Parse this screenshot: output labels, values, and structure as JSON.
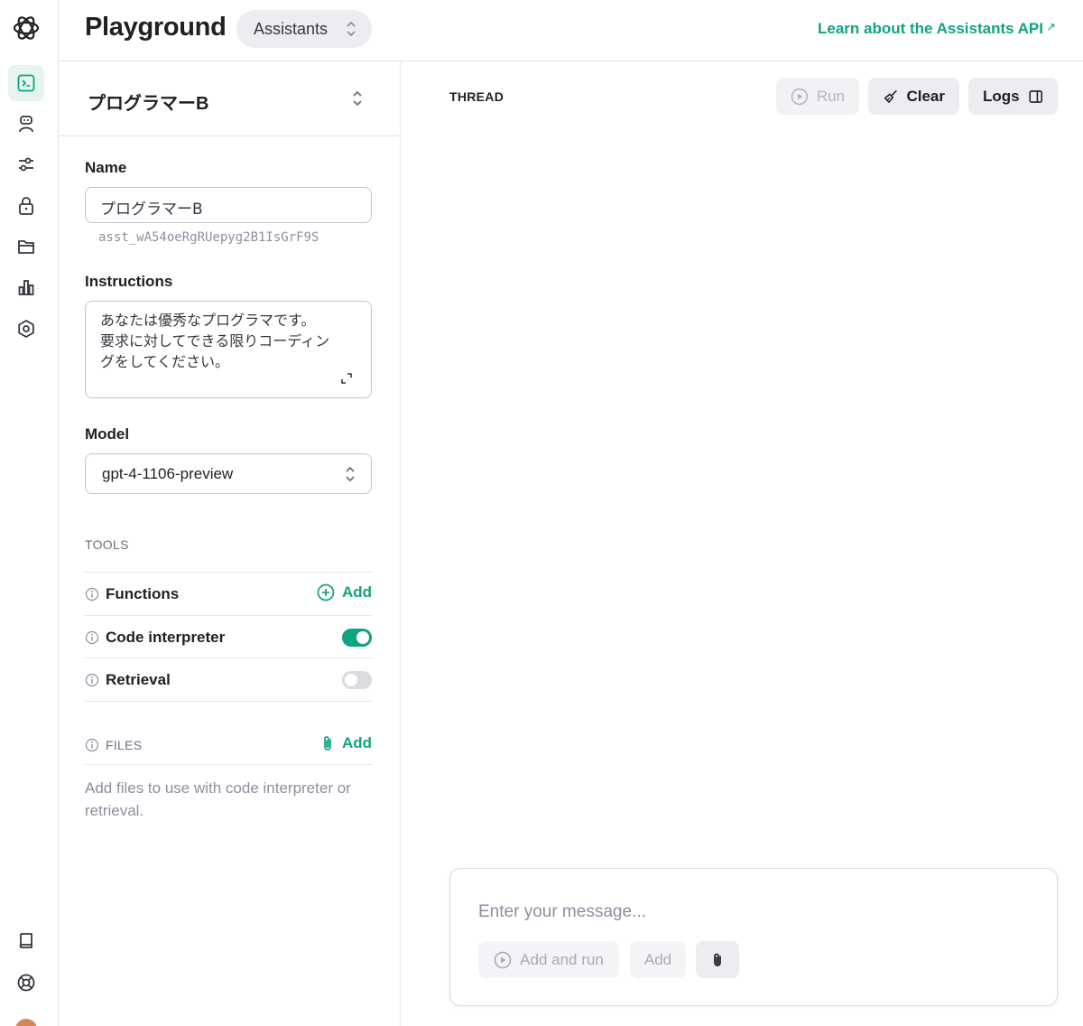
{
  "header": {
    "title": "Playground",
    "mode": "Assistants",
    "learn_link": "Learn about the Assistants API",
    "learn_arrow": "↗"
  },
  "rail": {
    "items": [
      "playground-icon",
      "assistant-icon",
      "tuning-icon",
      "lock-icon",
      "folder-icon",
      "usage-icon",
      "settings-icon"
    ],
    "bottom": [
      "docs-icon",
      "help-icon"
    ],
    "accent": "#10a37f"
  },
  "assistant": {
    "selected": "プログラマーB"
  },
  "form": {
    "name_label": "Name",
    "name_value": "プログラマーB",
    "assistant_id": "asst_wA54oeRgRUepyg2B1IsGrF9S",
    "instructions_label": "Instructions",
    "instructions_lines": [
      "あなたは優秀なプログラマです。",
      "要求に対してできる限りコーディン",
      "グをしてください。"
    ],
    "model_label": "Model",
    "model_value": "gpt-4-1106-preview"
  },
  "tools": {
    "heading": "TOOLS",
    "functions_label": "Functions",
    "functions_add": "Add",
    "code_interpreter_label": "Code interpreter",
    "code_interpreter_on": true,
    "retrieval_label": "Retrieval",
    "retrieval_on": false
  },
  "files": {
    "label": "FILES",
    "add": "Add",
    "hint": "Add files to use with code interpreter or retrieval."
  },
  "thread": {
    "label": "THREAD",
    "run": "Run",
    "clear": "Clear",
    "logs": "Logs"
  },
  "composer": {
    "placeholder": "Enter your message...",
    "add_and_run": "Add and run",
    "add": "Add"
  }
}
